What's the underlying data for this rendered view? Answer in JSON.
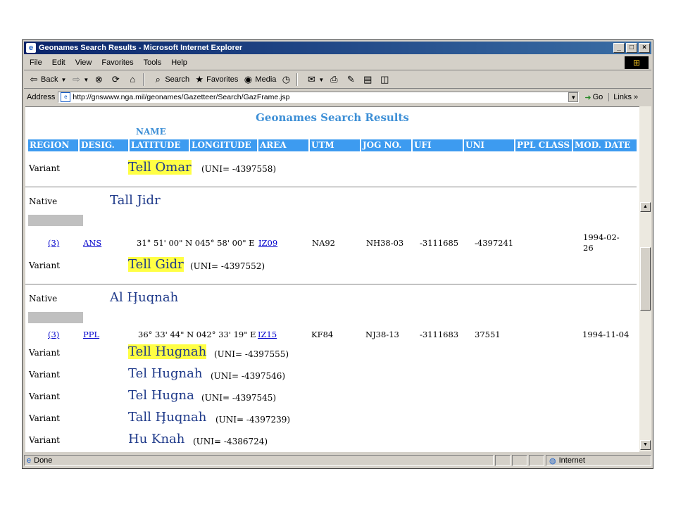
{
  "window": {
    "title": "Geonames Search Results - Microsoft Internet Explorer",
    "minimize": "_",
    "maximize": "□",
    "close": "×"
  },
  "menu": [
    "File",
    "Edit",
    "View",
    "Favorites",
    "Tools",
    "Help"
  ],
  "toolbar": {
    "back": "Back",
    "search": "Search",
    "favorites": "Favorites",
    "media": "Media"
  },
  "address": {
    "label": "Address",
    "url": "http://gnswww.nga.mil/geonames/Gazetteer/Search/GazFrame.jsp",
    "go": "Go",
    "links": "Links"
  },
  "page": {
    "title": "Geonames Search Results",
    "name_header": "NAME",
    "columns": [
      "REGION",
      "DESIG.",
      "LATITUDE",
      "LONGITUDE",
      "AREA",
      "UTM",
      "JOG NO.",
      "UFI",
      "UNI",
      "PPL CLASS",
      "MOD. DATE"
    ]
  },
  "entries": {
    "top_variant": {
      "type": "Variant",
      "name": "Tell Omar",
      "uni": "(UNI= -4397558)"
    },
    "jidr": {
      "native_label": "Native",
      "native_name": "Tall Jidr",
      "region": "(3)",
      "desig": "ANS",
      "coords": "31° 51' 00\" N 045° 58' 00\" E",
      "area": "IZ09",
      "utm": "NA92",
      "jog": "NH38-03",
      "ufi": "-3111685",
      "uni": "-4397241",
      "date_line1": "1994-02-",
      "date_line2": "26",
      "variant_label": "Variant",
      "variant_name": "Tell Gidr",
      "variant_uni": "(UNI= -4397552)"
    },
    "huqnah": {
      "native_label": "Native",
      "native_name": "Al Ḩuqnah",
      "region": "(3)",
      "desig": "PPL",
      "coords": "36° 33' 44\" N 042° 33' 19\" E",
      "area": "IZ15",
      "utm": "KF84",
      "jog": "NJ38-13",
      "ufi": "-3111683",
      "uni": "37551",
      "date": "1994-11-04",
      "variants": [
        {
          "label": "Variant",
          "name": "Tell Hugnah",
          "uni": "(UNI= -4397555)"
        },
        {
          "label": "Variant",
          "name": "Tel Hugnah",
          "uni": "(UNI= -4397546)"
        },
        {
          "label": "Variant",
          "name": "Tel Hugna",
          "uni": "(UNI= -4397545)"
        },
        {
          "label": "Variant",
          "name": "Tall Ḩuqnah",
          "uni": "(UNI= -4397239)"
        },
        {
          "label": "Variant",
          "name": "Hu Knah",
          "uni": "(UNI= -4386724)"
        }
      ]
    }
  },
  "status": {
    "text": "Done",
    "zone": "Internet"
  },
  "colors": {
    "header_bg": "#3d9bf0",
    "title_color": "#3d8fd6",
    "highlight": "#ffff44",
    "name_color": "#1f3a8a",
    "titlebar": "#0a246a"
  }
}
